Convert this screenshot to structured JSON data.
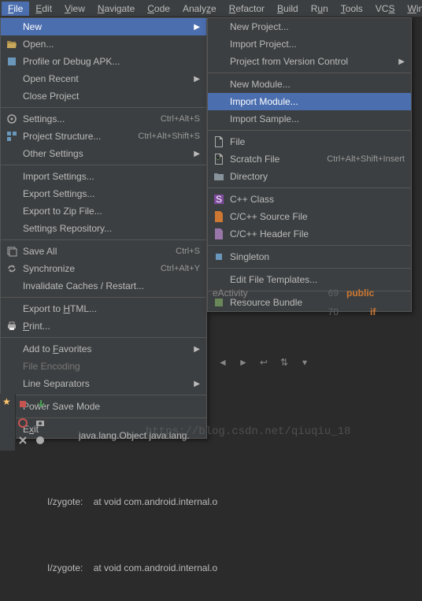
{
  "menubar": {
    "items": [
      {
        "label": "File",
        "ul": "F",
        "rest": "ile",
        "active": true
      },
      {
        "label": "Edit",
        "ul": "E",
        "rest": "dit"
      },
      {
        "label": "View",
        "ul": "V",
        "rest": "iew"
      },
      {
        "label": "Navigate",
        "ul": "N",
        "rest": "avigate"
      },
      {
        "label": "Code",
        "ul": "C",
        "rest": "ode"
      },
      {
        "label": "Analyze",
        "ul": "",
        "rest": "Analyze",
        "pre": "Analy",
        "ulc": "z",
        "post": "e"
      },
      {
        "label": "Refactor",
        "ul": "R",
        "rest": "efactor"
      },
      {
        "label": "Build",
        "ul": "B",
        "rest": "uild"
      },
      {
        "label": "Run",
        "ul": "",
        "rest": "",
        "pre": "R",
        "ulc": "u",
        "post": "n"
      },
      {
        "label": "Tools",
        "ul": "T",
        "rest": "ools"
      },
      {
        "label": "VCS",
        "ul": "",
        "rest": "",
        "pre": "VC",
        "ulc": "S",
        "post": ""
      },
      {
        "label": "Window",
        "ul": "W",
        "rest": "indow"
      }
    ]
  },
  "file_menu": {
    "new": "New",
    "open": "Open...",
    "profile": "Profile or Debug APK...",
    "open_recent": "Open Recent",
    "close_project": "Close Project",
    "settings": "Settings...",
    "settings_sc": "Ctrl+Alt+S",
    "project_structure": "Project Structure...",
    "project_structure_sc": "Ctrl+Alt+Shift+S",
    "other_settings": "Other Settings",
    "import_settings": "Import Settings...",
    "export_settings": "Export Settings...",
    "export_zip": "Export to Zip File...",
    "settings_repo": "Settings Repository...",
    "save_all": "Save All",
    "save_all_sc": "Ctrl+S",
    "sync": "Synchronize",
    "sync_sc": "Ctrl+Alt+Y",
    "invalidate": "Invalidate Caches / Restart...",
    "export_html_pre": "Export to ",
    "export_html_ul": "H",
    "export_html_post": "TML...",
    "print_ul": "P",
    "print_post": "rint...",
    "add_fav_pre": "Add to ",
    "add_fav_ul": "F",
    "add_fav_post": "avorites",
    "file_encoding": "File Encoding",
    "line_sep": "Line Separators",
    "power_save": "Power Save Mode",
    "exit_ul": "x",
    "exit_pre": "E",
    "exit_post": "it"
  },
  "new_menu": {
    "new_project": "New Project...",
    "import_project": "Import Project...",
    "vcs": "Project from Version Control",
    "new_module": "New Module...",
    "import_module": "Import Module...",
    "import_sample": "Import Sample...",
    "file": "File",
    "scratch": "Scratch File",
    "scratch_sc": "Ctrl+Alt+Shift+Insert",
    "directory": "Directory",
    "cpp_class": "C++ Class",
    "c_source": "C/C++ Source File",
    "c_header": "C/C++ Header File",
    "singleton": "Singleton",
    "edit_tmpl": "Edit File Templates...",
    "resource_bundle": "Resource Bundle"
  },
  "editor": {
    "tab_fragment": "eActivity",
    "line69": "69",
    "line70": "70",
    "kw_public": "public",
    "kw_if": "if"
  },
  "console": {
    "line1": "            java.lang.Object java.lang.",
    "line2_label": "I/zygote:",
    "line2_rest": "    at void com.android.internal.o",
    "line3_label": "I/zygote:",
    "line3_rest": "    at void com.android.internal.o"
  },
  "watermark": "https://blog.csdn.net/qiuqiu_18"
}
